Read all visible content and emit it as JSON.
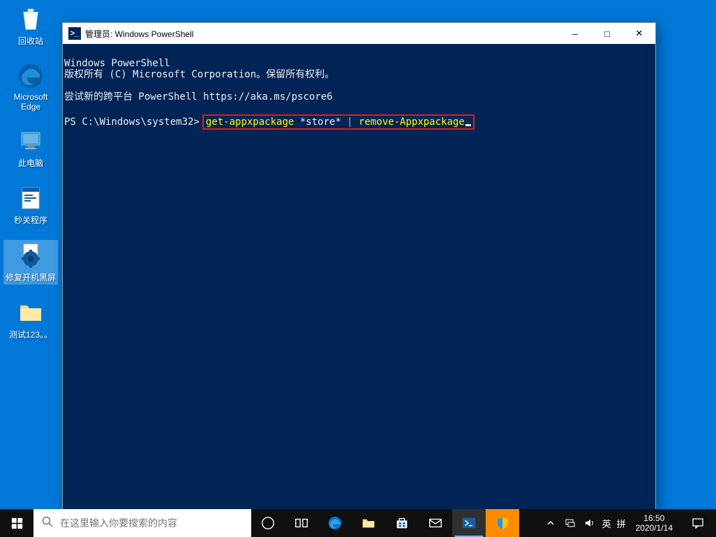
{
  "desktop": {
    "icons": [
      {
        "label": "回收站",
        "type": "recycle"
      },
      {
        "label": "Microsoft Edge",
        "type": "edge"
      },
      {
        "label": "此电脑",
        "type": "pc"
      },
      {
        "label": "秒关程序",
        "type": "notepad"
      },
      {
        "label": "修复开机黑屏",
        "type": "gear",
        "selected": true
      },
      {
        "label": "测试123。。",
        "type": "folder"
      }
    ]
  },
  "window": {
    "title": "管理员: Windows PowerShell",
    "console": {
      "line1": "Windows PowerShell",
      "line2": "版权所有 (C) Microsoft Corporation。保留所有权利。",
      "line3": "尝试新的跨平台 PowerShell https://aka.ms/pscore6",
      "prompt": "PS C:\\Windows\\system32>",
      "cmd1a": "get-appxpackage",
      "cmd1b": " *store* ",
      "pipe": "|",
      "cmd2a": " remove-Appxpackage"
    }
  },
  "taskbar": {
    "search_placeholder": "在这里输入你要搜索的内容"
  },
  "systray": {
    "lang": "英",
    "ime": "拼",
    "time": "16:50",
    "date": "2020/1/14"
  }
}
